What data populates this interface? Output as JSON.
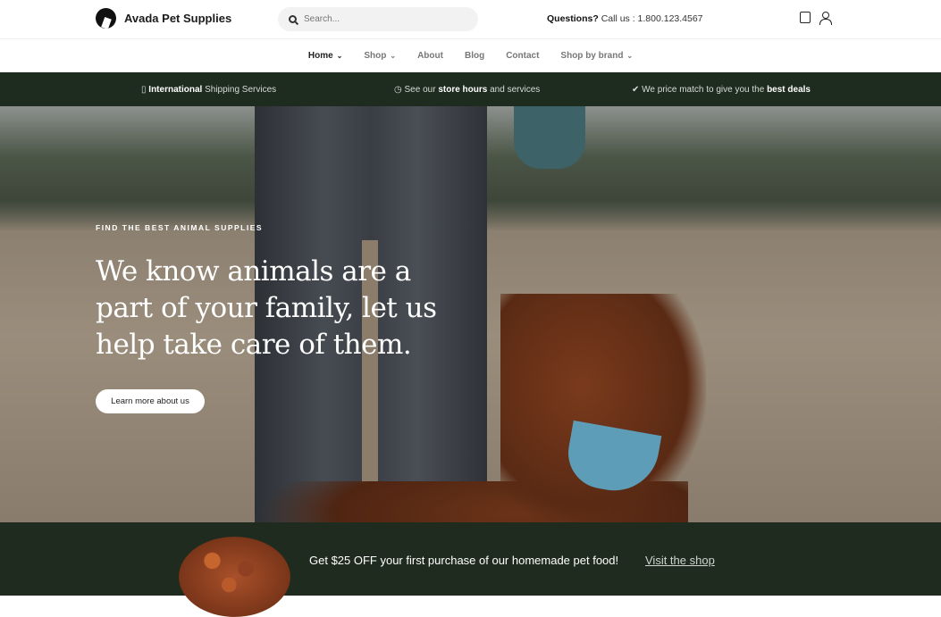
{
  "header": {
    "brand": "Avada Pet Supplies",
    "search_placeholder": "Search...",
    "questions_label": "Questions?",
    "call_text": "Call us : 1.800.123.4567"
  },
  "nav": {
    "items": [
      {
        "label": "Home",
        "dropdown": true,
        "active": true
      },
      {
        "label": "Shop",
        "dropdown": true
      },
      {
        "label": "About"
      },
      {
        "label": "Blog"
      },
      {
        "label": "Contact"
      },
      {
        "label": "Shop by brand",
        "dropdown": true
      }
    ]
  },
  "info_bar": {
    "shipping": {
      "bold": "International",
      "text": "Shipping Services"
    },
    "hours": {
      "pre": "See our",
      "bold": "store hours",
      "post": "and services"
    },
    "price": {
      "pre": "We price match to give you the",
      "bold": "best deals"
    }
  },
  "hero": {
    "kicker": "FIND THE BEST ANIMAL SUPPLIES",
    "headline": "We know animals are a part of your family, let us help take care of them.",
    "cta": "Learn more about us"
  },
  "promo": {
    "text": "Get $25 OFF your first purchase of our homemade pet food!",
    "link": "Visit the shop"
  },
  "colors": {
    "dark_green": "#1e2b1f"
  }
}
